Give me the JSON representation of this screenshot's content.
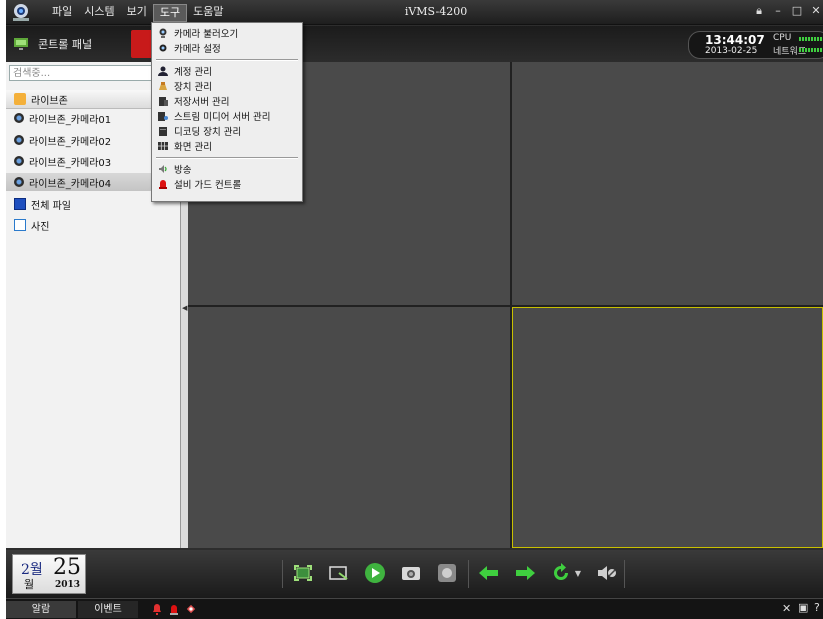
{
  "app": {
    "title": "iVMS-4200",
    "menu": [
      "파일",
      "시스템",
      "보기",
      "도구",
      "도움말"
    ],
    "active_menu": "도구"
  },
  "control_panel": {
    "label": "콘트롤 패널"
  },
  "status": {
    "time": "13:44:07",
    "date": "2013-02-25",
    "cpu_label": "CPU",
    "network_label": "네트워크"
  },
  "search": {
    "placeholder": "검색중..."
  },
  "tree": {
    "group": "라이브존",
    "cameras": [
      "라이브존_카메라01",
      "라이브존_카메라02",
      "라이브존_카메라03",
      "라이브존_카메라04"
    ],
    "selected_camera": "라이브존_카메라04",
    "all_files": "전체 파일",
    "photos": "사진"
  },
  "tools_menu": {
    "items": [
      {
        "label": "카메라 불러오기",
        "icon": "camera-load-icon"
      },
      {
        "label": "카메라 설정",
        "icon": "camera-settings-icon"
      },
      {
        "label": "계정 관리",
        "icon": "user-icon"
      },
      {
        "label": "장치 관리",
        "icon": "device-icon"
      },
      {
        "label": "저장서버 관리",
        "icon": "storage-server-icon"
      },
      {
        "label": "스트림 미디어 서버 관리",
        "icon": "stream-server-icon"
      },
      {
        "label": "디코딩 장치 관리",
        "icon": "decoder-icon"
      },
      {
        "label": "화면 관리",
        "icon": "screen-grid-icon"
      },
      {
        "label": "방송",
        "icon": "broadcast-icon"
      },
      {
        "label": "설비 가드 컨트롤",
        "icon": "guard-alarm-icon"
      }
    ]
  },
  "date_widget": {
    "month": "2월",
    "wol": "월",
    "day": "25",
    "year": "2013"
  },
  "bottom_toolbar": [
    "fullscreen-icon",
    "window-split-icon",
    "play-icon",
    "snapshot-icon",
    "record-icon",
    "previous-icon",
    "next-icon",
    "refresh-icon",
    "volume-mute-icon"
  ],
  "statusbar": {
    "alarm_tab": "알람",
    "event_tab": "이벤트"
  },
  "colors": {
    "selection_border": "#c8c000",
    "tile": "#4a4a4a",
    "accent_green": "#3fcf3f"
  }
}
